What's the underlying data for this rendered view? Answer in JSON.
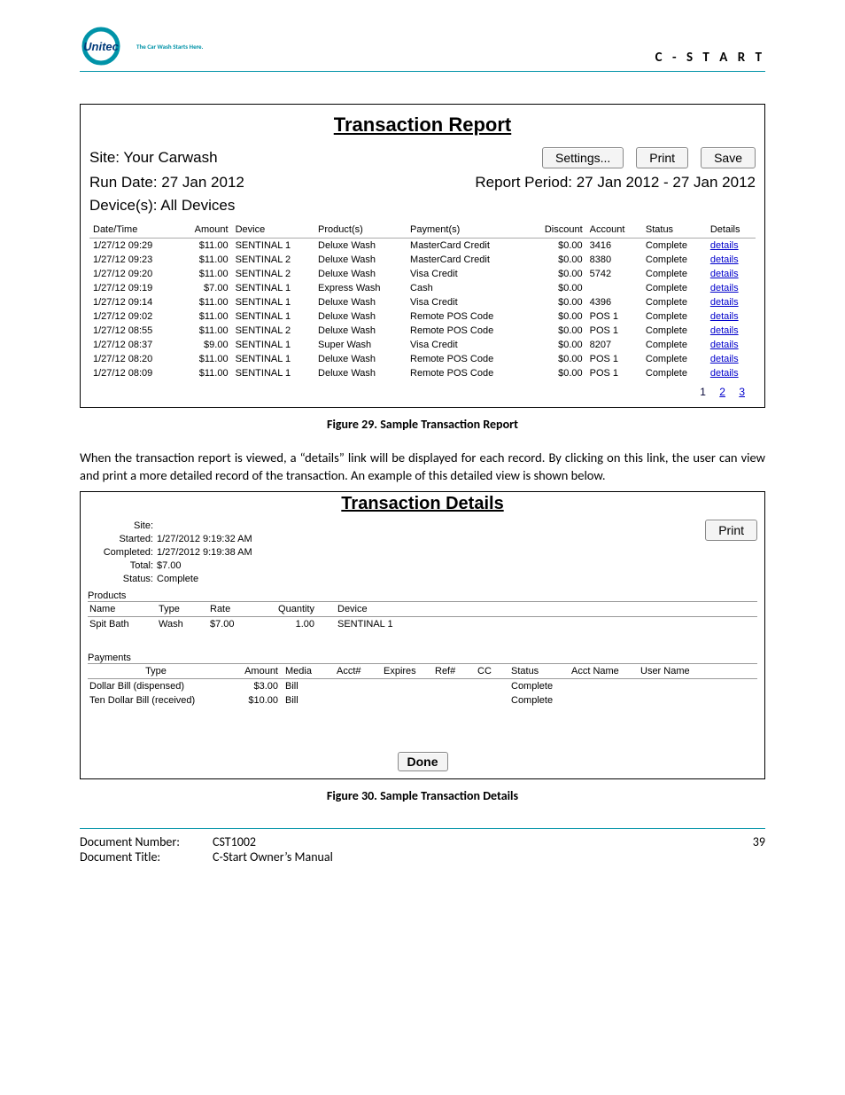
{
  "header": {
    "logo_tag": "The Car Wash Starts Here.",
    "right": "C - S T A R T"
  },
  "report": {
    "title": "Transaction Report",
    "site_label": "Site: Your Carwash",
    "buttons": {
      "settings": "Settings...",
      "print": "Print",
      "save": "Save"
    },
    "run_date": "Run Date: 27 Jan 2012",
    "period": "Report Period: 27 Jan 2012 - 27 Jan 2012",
    "devices": "Device(s): All Devices",
    "columns": [
      "Date/Time",
      "Amount",
      "Device",
      "Product(s)",
      "Payment(s)",
      "Discount",
      "Account",
      "Status",
      "Details"
    ],
    "rows": [
      {
        "dt": "1/27/12 09:29",
        "amt": "$11.00",
        "dev": "SENTINAL 1",
        "prod": "Deluxe Wash",
        "pay": "MasterCard Credit",
        "disc": "$0.00",
        "acct": "3416",
        "stat": "Complete",
        "det": "details"
      },
      {
        "dt": "1/27/12 09:23",
        "amt": "$11.00",
        "dev": "SENTINAL 2",
        "prod": "Deluxe Wash",
        "pay": "MasterCard Credit",
        "disc": "$0.00",
        "acct": "8380",
        "stat": "Complete",
        "det": "details"
      },
      {
        "dt": "1/27/12 09:20",
        "amt": "$11.00",
        "dev": "SENTINAL 2",
        "prod": "Deluxe Wash",
        "pay": "Visa Credit",
        "disc": "$0.00",
        "acct": "5742",
        "stat": "Complete",
        "det": "details"
      },
      {
        "dt": "1/27/12 09:19",
        "amt": "$7.00",
        "dev": "SENTINAL 1",
        "prod": "Express Wash",
        "pay": "Cash",
        "disc": "$0.00",
        "acct": "",
        "stat": "Complete",
        "det": "details"
      },
      {
        "dt": "1/27/12 09:14",
        "amt": "$11.00",
        "dev": "SENTINAL 1",
        "prod": "Deluxe Wash",
        "pay": "Visa Credit",
        "disc": "$0.00",
        "acct": "4396",
        "stat": "Complete",
        "det": "details"
      },
      {
        "dt": "1/27/12 09:02",
        "amt": "$11.00",
        "dev": "SENTINAL 1",
        "prod": "Deluxe Wash",
        "pay": "Remote POS Code",
        "disc": "$0.00",
        "acct": "POS 1",
        "stat": "Complete",
        "det": "details"
      },
      {
        "dt": "1/27/12 08:55",
        "amt": "$11.00",
        "dev": "SENTINAL 2",
        "prod": "Deluxe Wash",
        "pay": "Remote POS Code",
        "disc": "$0.00",
        "acct": "POS 1",
        "stat": "Complete",
        "det": "details"
      },
      {
        "dt": "1/27/12 08:37",
        "amt": "$9.00",
        "dev": "SENTINAL 1",
        "prod": "Super Wash",
        "pay": "Visa Credit",
        "disc": "$0.00",
        "acct": "8207",
        "stat": "Complete",
        "det": "details"
      },
      {
        "dt": "1/27/12 08:20",
        "amt": "$11.00",
        "dev": "SENTINAL 1",
        "prod": "Deluxe Wash",
        "pay": "Remote POS Code",
        "disc": "$0.00",
        "acct": "POS 1",
        "stat": "Complete",
        "det": "details"
      },
      {
        "dt": "1/27/12 08:09",
        "amt": "$11.00",
        "dev": "SENTINAL 1",
        "prod": "Deluxe Wash",
        "pay": "Remote POS Code",
        "disc": "$0.00",
        "acct": "POS 1",
        "stat": "Complete",
        "det": "details"
      }
    ],
    "pager": {
      "current": "1",
      "p2": "2",
      "p3": "3"
    }
  },
  "fig29": "Figure 29. Sample Transaction Report",
  "para": "When the transaction report is viewed, a “details” link will be displayed for each record. By clicking on this link, the user can view and print a more detailed record of the transaction. An example of this detailed view is shown below.",
  "details": {
    "title": "Transaction Details",
    "print": "Print",
    "info": {
      "site_lbl": "Site:",
      "site_val": "",
      "started_lbl": "Started:",
      "started_val": "1/27/2012 9:19:32 AM",
      "completed_lbl": "Completed:",
      "completed_val": "1/27/2012 9:19:38 AM",
      "total_lbl": "Total:",
      "total_val": "$7.00",
      "status_lbl": "Status:",
      "status_val": "Complete"
    },
    "products_label": "Products",
    "prod_cols": [
      "Name",
      "Type",
      "Rate",
      "Quantity",
      "Device"
    ],
    "prod_rows": [
      {
        "name": "Spit Bath",
        "type": "Wash",
        "rate": "$7.00",
        "qty": "1.00",
        "dev": "SENTINAL 1"
      }
    ],
    "payments_label": "Payments",
    "pay_cols": [
      "Type",
      "Amount",
      "Media",
      "Acct#",
      "Expires",
      "Ref#",
      "CC",
      "Status",
      "Acct Name",
      "User Name"
    ],
    "pay_rows": [
      {
        "type": "Dollar Bill (dispensed)",
        "amt": "$3.00",
        "media": "Bill",
        "acct": "",
        "exp": "",
        "ref": "",
        "cc": "",
        "stat": "Complete",
        "an": "",
        "un": ""
      },
      {
        "type": "Ten Dollar Bill (received)",
        "amt": "$10.00",
        "media": "Bill",
        "acct": "",
        "exp": "",
        "ref": "",
        "cc": "",
        "stat": "Complete",
        "an": "",
        "un": ""
      }
    ],
    "done": "Done"
  },
  "fig30": "Figure 30. Sample Transaction Details",
  "footer": {
    "docnum_k": "Document Number:",
    "docnum_v": "CST1002",
    "doct_k": "Document Title:",
    "doct_v": "C-Start Owner’s Manual",
    "page": "39"
  }
}
